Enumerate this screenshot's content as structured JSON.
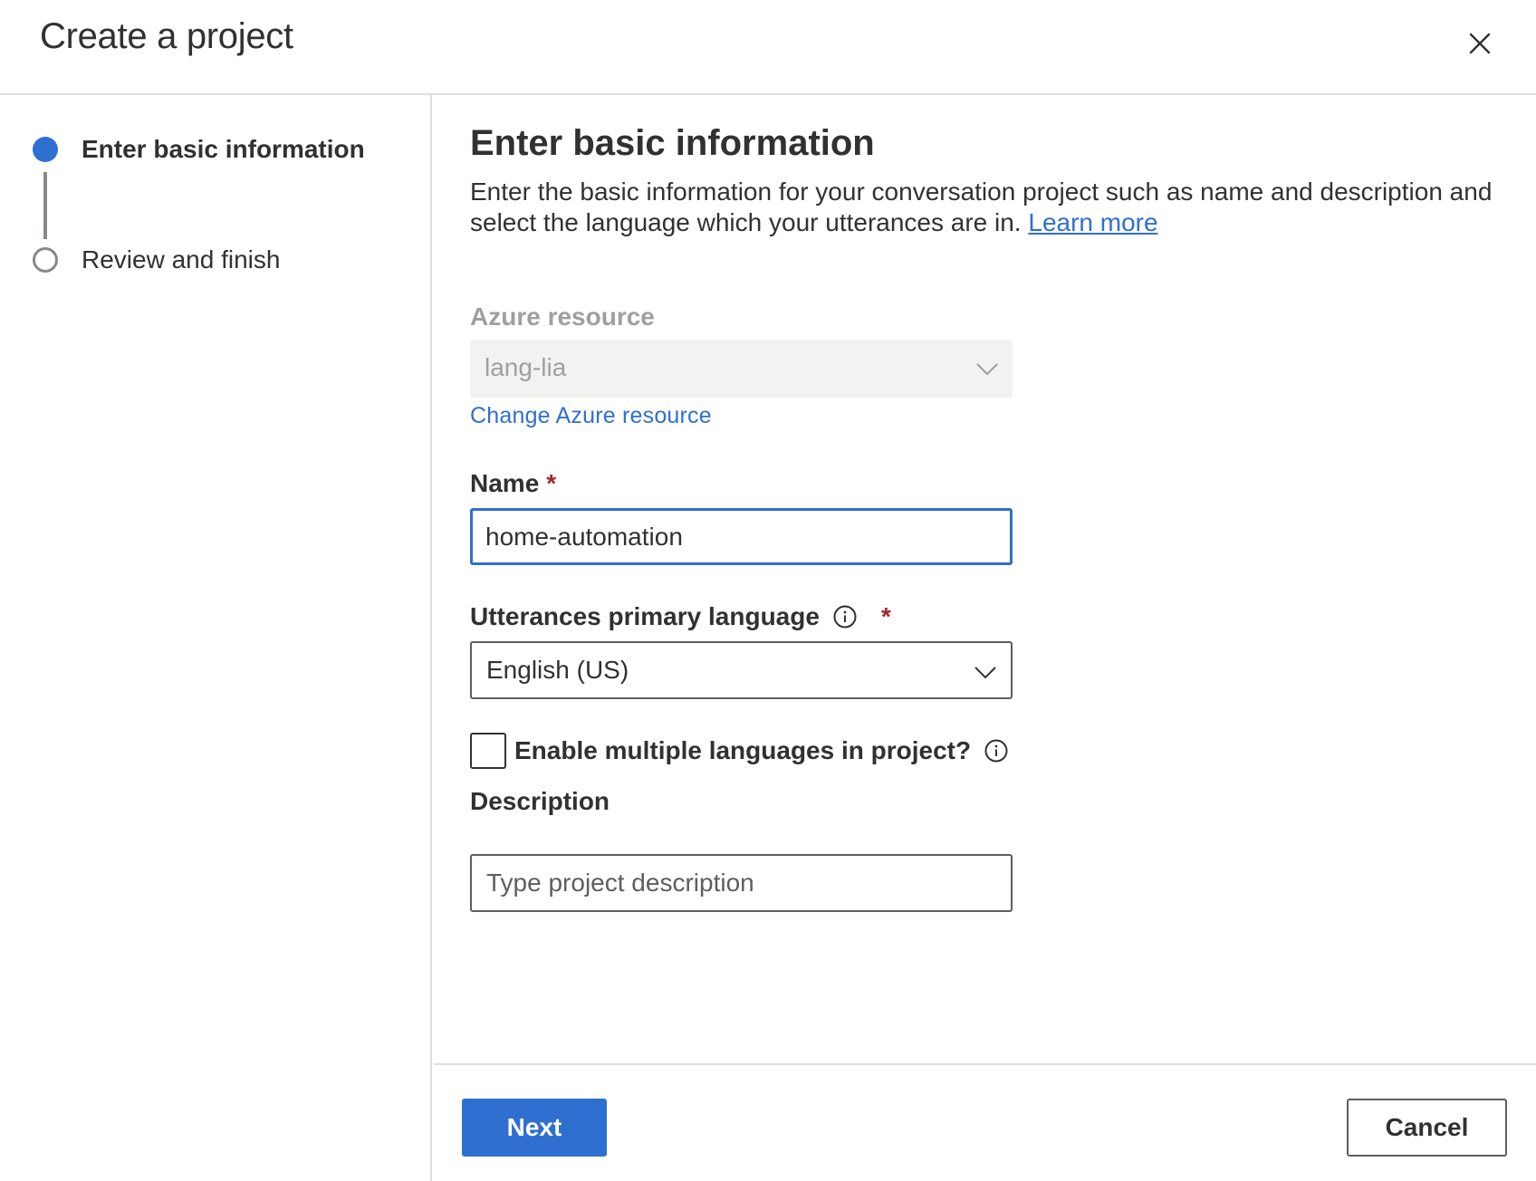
{
  "dialog": {
    "title": "Create a project",
    "close_icon": "close-icon"
  },
  "steps": [
    {
      "label": "Enter basic information",
      "state": "active"
    },
    {
      "label": "Review and finish",
      "state": "pending"
    }
  ],
  "main": {
    "heading": "Enter basic information",
    "description": "Enter the basic information for your conversation project such as name and description and select the language which your utterances are in.",
    "learn_more": "Learn more"
  },
  "form": {
    "azure_resource": {
      "label": "Azure resource",
      "value": "lang-lia",
      "disabled": true,
      "change_link": "Change Azure resource"
    },
    "name": {
      "label": "Name",
      "required_mark": "*",
      "value": "home-automation"
    },
    "language": {
      "label": "Utterances primary language",
      "required_mark": "*",
      "value": "English (US)",
      "info_icon": "info-icon"
    },
    "multilingual": {
      "label": "Enable multiple languages in project?",
      "checked": false,
      "info_icon": "info-icon"
    },
    "description": {
      "label": "Description",
      "placeholder": "Type project description",
      "value": ""
    }
  },
  "footer": {
    "next_label": "Next",
    "cancel_label": "Cancel"
  },
  "colors": {
    "accent": "#2f6fd0",
    "required": "#a4262c",
    "disabled_text": "#a19f9d",
    "disabled_bg": "#f3f2f1",
    "divider": "#e1dfdd"
  }
}
